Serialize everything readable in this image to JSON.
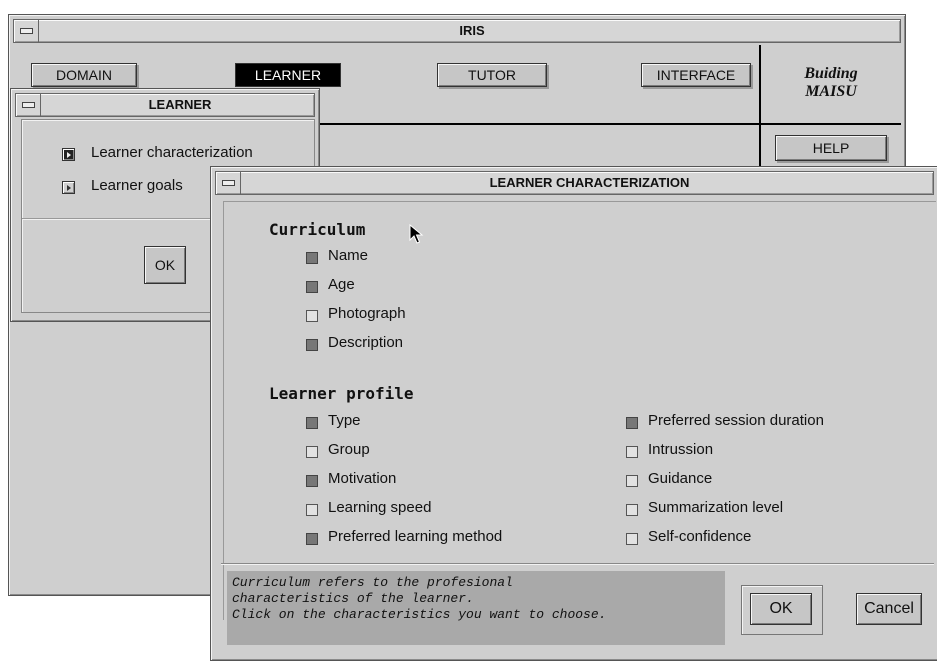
{
  "iris": {
    "title": "IRIS",
    "tabs": [
      "DOMAIN",
      "LEARNER",
      "TUTOR",
      "INTERFACE"
    ],
    "brand_line1": "Buiding",
    "brand_line2": "MAISU",
    "help_label": "HELP"
  },
  "learner_window": {
    "title": "LEARNER",
    "items": [
      "Learner characterization",
      "Learner goals"
    ],
    "ok_label": "OK"
  },
  "characterization": {
    "title": "LEARNER CHARACTERIZATION",
    "curriculum_heading": "Curriculum",
    "curriculum": [
      {
        "label": "Name",
        "checked": true
      },
      {
        "label": "Age",
        "checked": true
      },
      {
        "label": "Photograph",
        "checked": false
      },
      {
        "label": "Description",
        "checked": true
      }
    ],
    "profile_heading": "Learner profile",
    "profile_left": [
      {
        "label": "Type",
        "checked": true
      },
      {
        "label": "Group",
        "checked": false
      },
      {
        "label": "Motivation",
        "checked": true
      },
      {
        "label": "Learning speed",
        "checked": false
      },
      {
        "label": "Preferred learning method",
        "checked": true
      }
    ],
    "profile_right": [
      {
        "label": "Preferred session duration",
        "checked": true
      },
      {
        "label": "Intrussion",
        "checked": false
      },
      {
        "label": "Guidance",
        "checked": false
      },
      {
        "label": "Summarization level",
        "checked": false
      },
      {
        "label": "Self-confidence",
        "checked": false
      }
    ],
    "info_lines": [
      "Curriculum refers to the profesional",
      "characteristics of the learner.",
      "Click on the characteristics you want to choose."
    ],
    "ok_label": "OK",
    "cancel_label": "Cancel"
  },
  "colors": {
    "window_bg": "#cfcfcf",
    "checked_fill": "#777777",
    "info_bg": "#a9a9a9",
    "active_tab_bg": "#000000"
  }
}
